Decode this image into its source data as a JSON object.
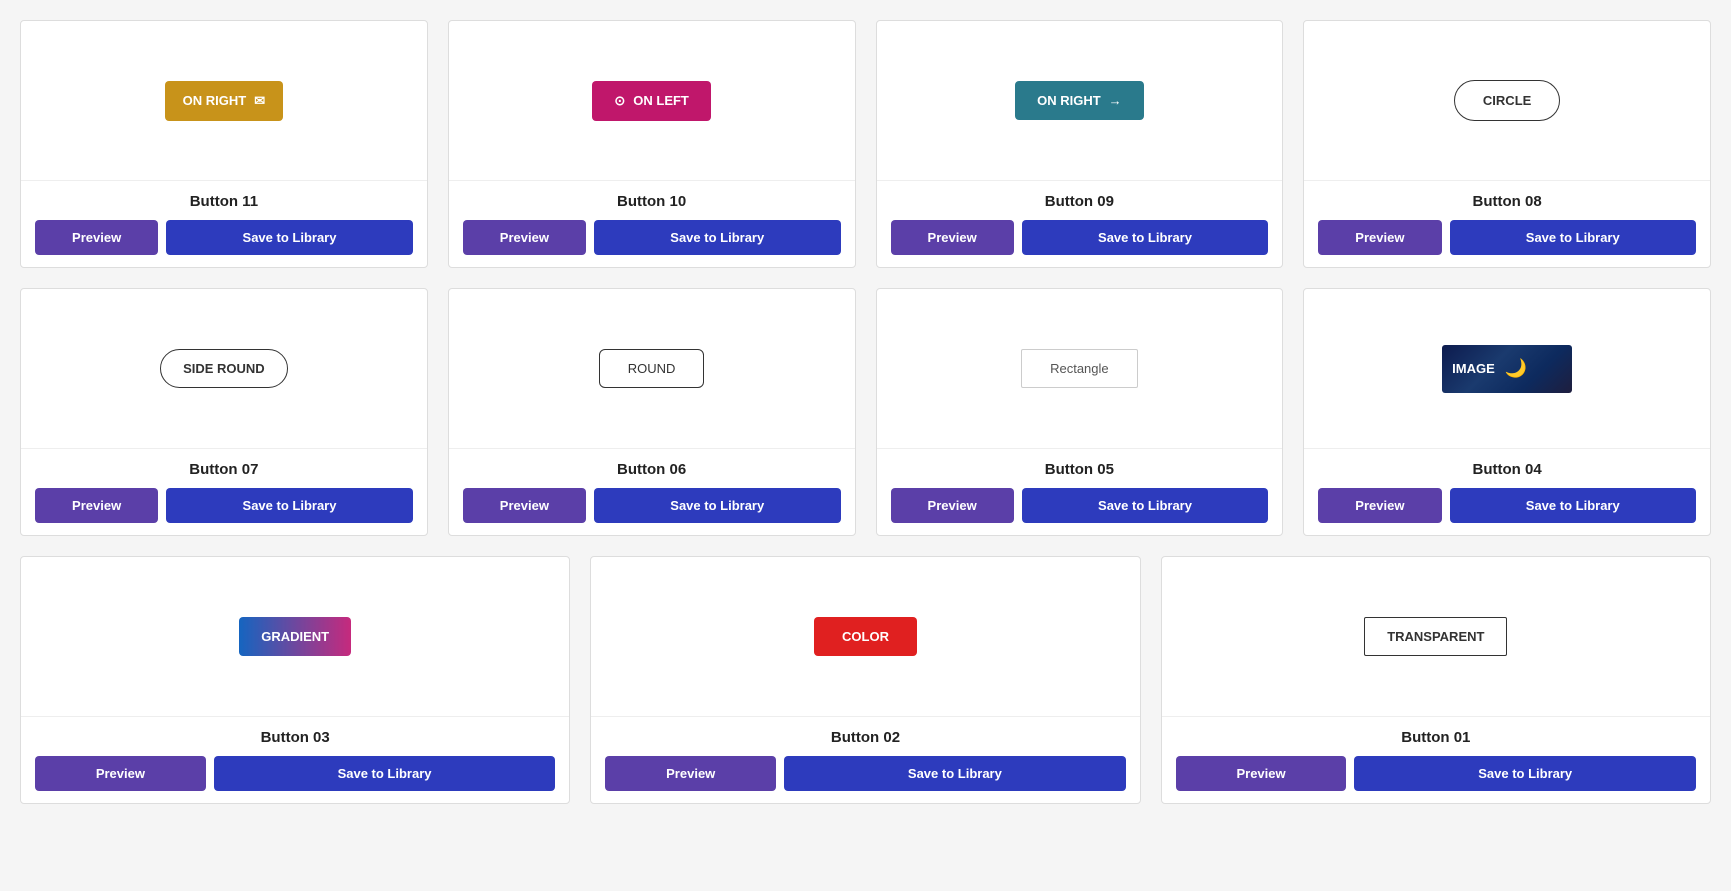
{
  "rows": [
    {
      "cards": [
        {
          "id": "btn11",
          "title": "Button 11",
          "preview_type": "on-right-gold",
          "preview_label": "ON RIGHT",
          "preview_icon_right": "✉",
          "actions": {
            "preview": "Preview",
            "save": "Save to Library"
          }
        },
        {
          "id": "btn10",
          "title": "Button 10",
          "preview_type": "on-left-pink",
          "preview_label": "ON LEFT",
          "preview_icon_left": "⊙",
          "actions": {
            "preview": "Preview",
            "save": "Save to Library"
          }
        },
        {
          "id": "btn09",
          "title": "Button 09",
          "preview_type": "on-right-teal",
          "preview_label": "ON RIGHT",
          "preview_icon_right": "→",
          "actions": {
            "preview": "Preview",
            "save": "Save to Library"
          }
        },
        {
          "id": "btn08",
          "title": "Button 08",
          "preview_type": "circle",
          "preview_label": "CIRCLE",
          "actions": {
            "preview": "Preview",
            "save": "Save to Library"
          }
        }
      ]
    },
    {
      "cards": [
        {
          "id": "btn07",
          "title": "Button 07",
          "preview_type": "side-round",
          "preview_label": "SIDE ROUND",
          "actions": {
            "preview": "Preview",
            "save": "Save to Library"
          }
        },
        {
          "id": "btn06",
          "title": "Button 06",
          "preview_type": "round",
          "preview_label": "ROUND",
          "actions": {
            "preview": "Preview",
            "save": "Save to Library"
          }
        },
        {
          "id": "btn05",
          "title": "Button 05",
          "preview_type": "rectangle",
          "preview_label": "Rectangle",
          "actions": {
            "preview": "Preview",
            "save": "Save to Library"
          }
        },
        {
          "id": "btn04",
          "title": "Button 04",
          "preview_type": "image",
          "preview_label": "IMAGE",
          "actions": {
            "preview": "Preview",
            "save": "Save to Library"
          }
        }
      ]
    }
  ],
  "row3": {
    "cards": [
      {
        "id": "btn03",
        "title": "Button 03",
        "preview_type": "gradient",
        "preview_label": "GRADIENT",
        "actions": {
          "preview": "Preview",
          "save": "Save to Library"
        }
      },
      {
        "id": "btn02",
        "title": "Button 02",
        "preview_type": "color",
        "preview_label": "COLOR",
        "actions": {
          "preview": "Preview",
          "save": "Save to Library"
        }
      },
      {
        "id": "btn01",
        "title": "Button 01",
        "preview_type": "transparent",
        "preview_label": "TRANSPARENT",
        "actions": {
          "preview": "Preview",
          "save": "Save to Library"
        }
      }
    ]
  },
  "labels": {
    "btn11_label": "ON RIGHT",
    "btn10_label": "ON LEFT",
    "btn09_label": "ON RIGHT",
    "btn08_label": "CIRCLE",
    "btn07_label": "SIDE ROUND",
    "btn06_label": "ROUND",
    "btn05_label": "Rectangle",
    "btn04_label": "IMAGE",
    "btn03_label": "GRADIENT",
    "btn02_label": "COLOR",
    "btn01_label": "TRANSPARENT",
    "title_btn11": "Button 11",
    "title_btn10": "Button 10",
    "title_btn09": "Button 09",
    "title_btn08": "Button 08",
    "title_btn07": "Button 07",
    "title_btn06": "Button 06",
    "title_btn05": "Button 05",
    "title_btn04": "Button 04",
    "title_btn03": "Button 03",
    "title_btn02": "Button 02",
    "title_btn01": "Button 01",
    "preview": "Preview",
    "save": "Save to Library"
  }
}
